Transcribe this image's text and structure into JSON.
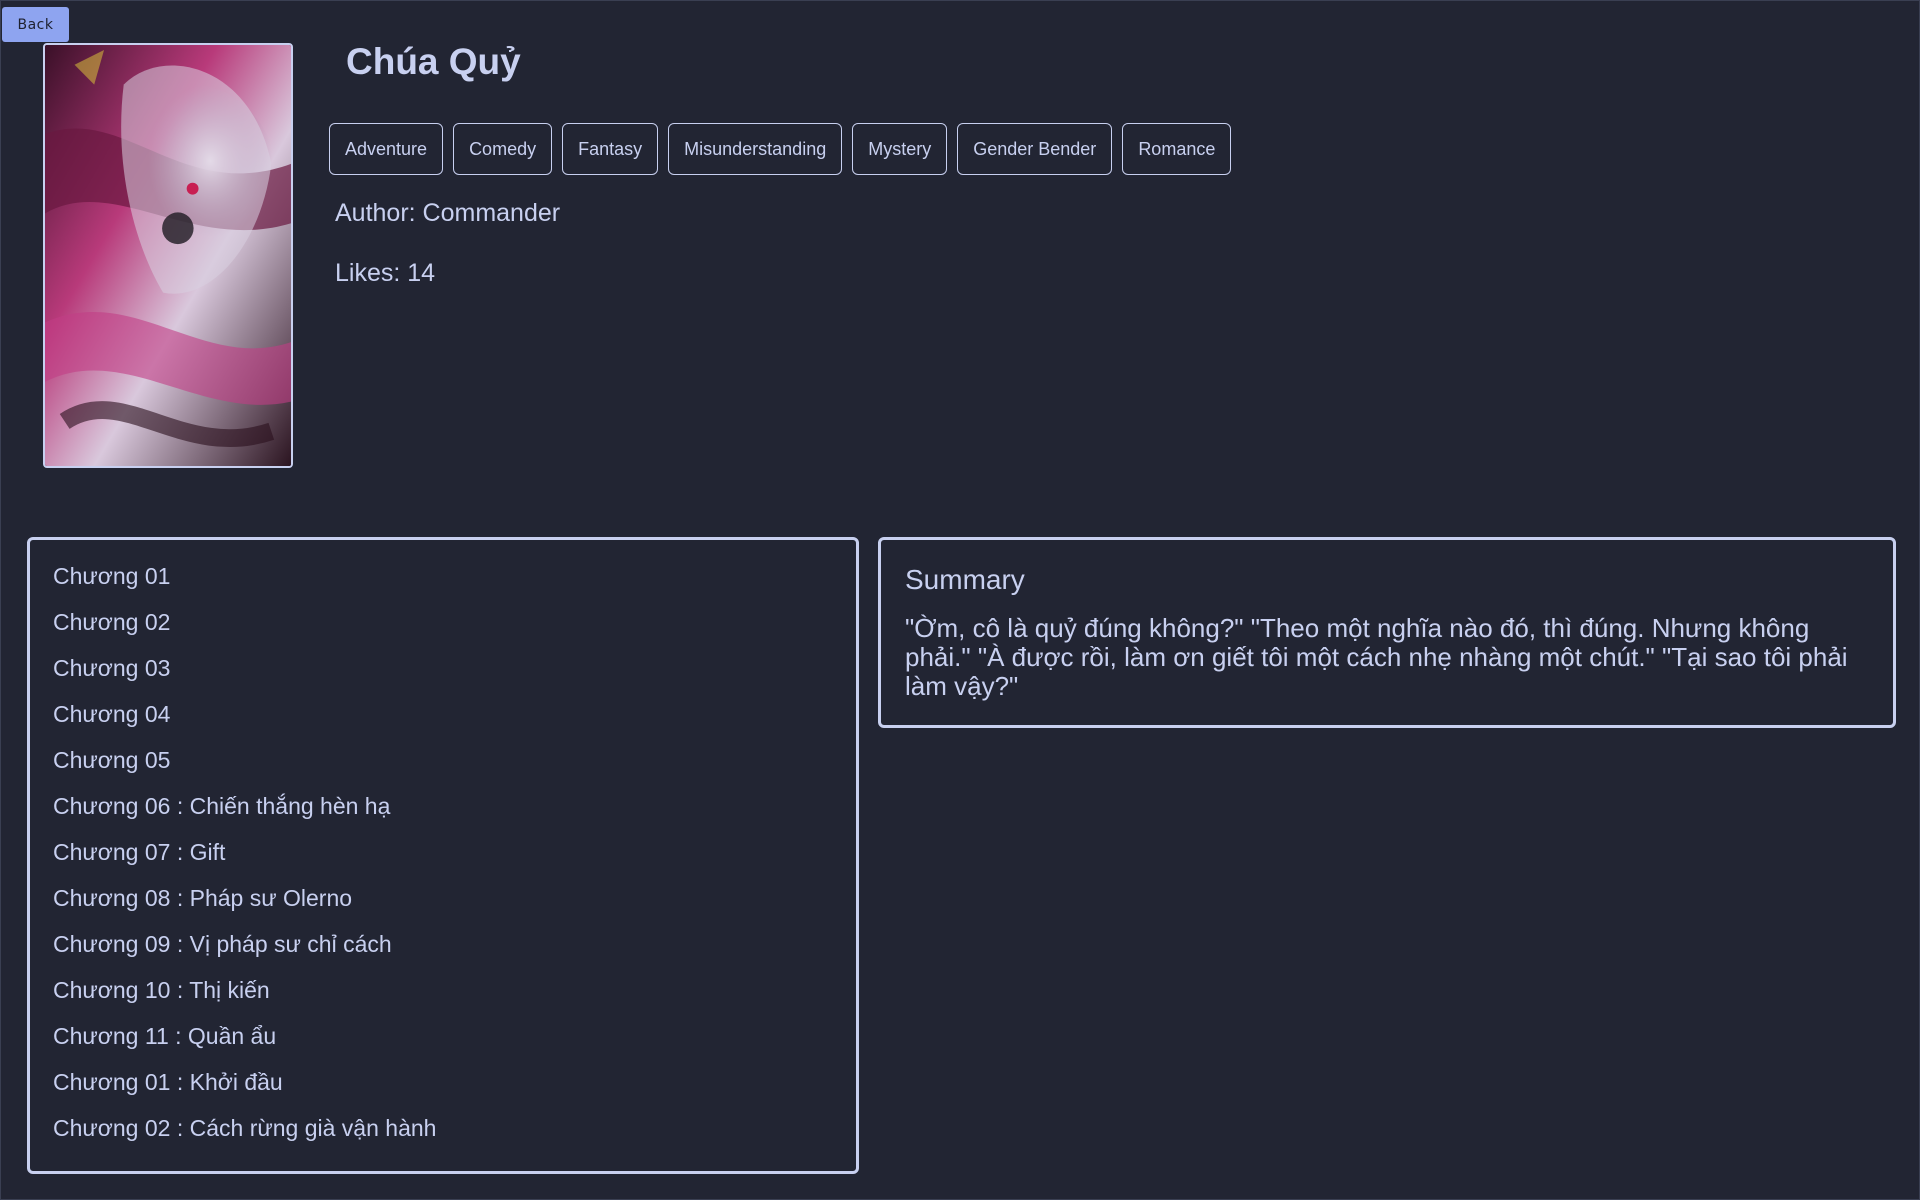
{
  "back_label": "Back",
  "novel": {
    "title": "Chúa Quỷ",
    "tags": [
      "Adventure",
      "Comedy",
      "Fantasy",
      "Misunderstanding",
      "Mystery",
      "Gender Bender",
      "Romance"
    ],
    "author": "Author: Commander",
    "likes": "Likes: 14"
  },
  "chapters": [
    "Chương 01",
    "Chương 02",
    "Chương 03",
    "Chương 04",
    "Chương 05",
    "Chương 06 : Chiến thắng hèn hạ",
    "Chương 07 : Gift",
    "Chương 08 : Pháp sư Olerno",
    "Chương 09 : Vị pháp sư chỉ cách",
    "Chương 10 : Thị kiến",
    "Chương 11 : Quần ẩu",
    "Chương 01 : Khởi đầu",
    "Chương 02 : Cách rừng già vận hành"
  ],
  "summary": {
    "heading": "Summary",
    "text": "\"Ờm, cô là quỷ đúng không?\" \"Theo một nghĩa nào đó, thì đúng. Nhưng không phải.\" \"À được rồi, làm ơn giết tôi một cách nhẹ nhàng một chút.\" \"Tại sao tôi phải làm vậy?\""
  },
  "colors": {
    "background": "#222533",
    "text": "#c8d0f0",
    "back_button": "#8ea4f0"
  }
}
